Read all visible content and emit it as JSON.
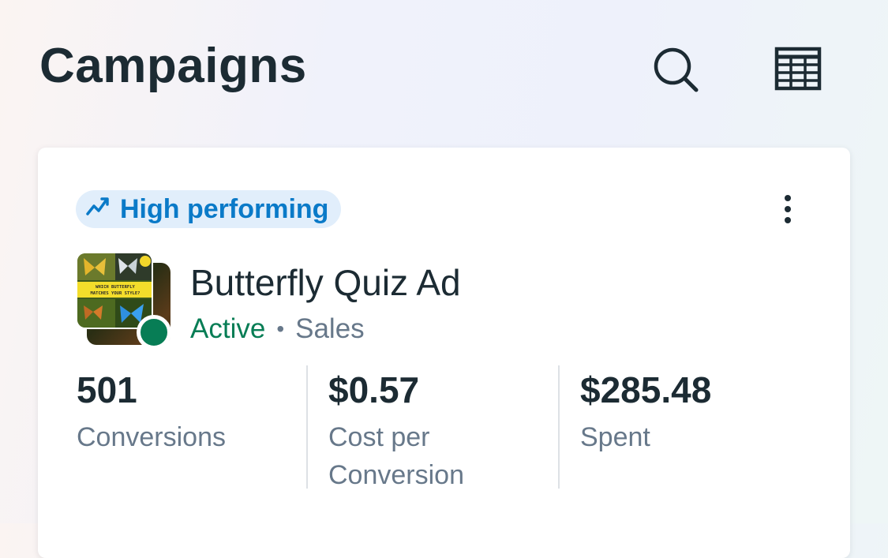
{
  "header": {
    "title": "Campaigns",
    "search_icon": "search-icon",
    "table_icon": "table-view-icon"
  },
  "campaign": {
    "badge": {
      "icon": "trend-up-icon",
      "label": "High performing"
    },
    "more_icon": "more-vertical-icon",
    "thumbnail_text": "WHICH BUTTERFLY MATCHES YOUR STYLE?",
    "name": "Butterfly Quiz Ad",
    "status": "Active",
    "separator": "•",
    "objective": "Sales",
    "stats": [
      {
        "value": "501",
        "label": "Conversions"
      },
      {
        "value": "$0.57",
        "label": "Cost per Conversion"
      },
      {
        "value": "$285.48",
        "label": "Spent"
      }
    ]
  },
  "colors": {
    "title_text": "#1c2b33",
    "badge_bg": "#e1eefb",
    "badge_text": "#0a7ac8",
    "active_green": "#077d55",
    "secondary_text": "#67788a",
    "divider": "#dde1e5"
  }
}
